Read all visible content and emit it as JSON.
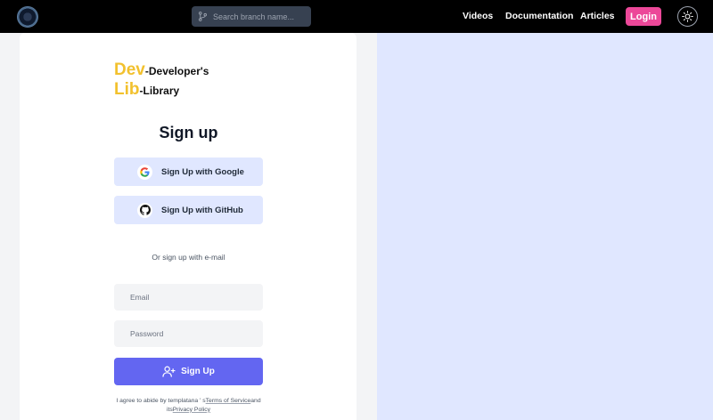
{
  "navbar": {
    "search_placeholder": "Search branch name...",
    "links": {
      "videos": "Videos",
      "documentation": "Documentation",
      "articles": "Articles"
    },
    "login_label": "Login",
    "icons": {
      "logo": "app-logo",
      "search": "git-branch-icon",
      "theme": "sun-icon"
    }
  },
  "brand": {
    "line1_big": "Dev",
    "line1_small": "-Developer's",
    "line2_big": "Lib",
    "line2_small": "-Library"
  },
  "signup": {
    "title": "Sign up",
    "google_label": "Sign Up with Google",
    "github_label": "Sign Up with GitHub",
    "divider": "Or sign up with e-mail",
    "email_placeholder": "Email",
    "password_placeholder": "Password",
    "submit_label": "Sign Up",
    "terms_prefix": "I agree to abide by templatana ' s",
    "terms_link": "Terms of Service",
    "terms_middle": "and its",
    "privacy_link": "Privacy Policy"
  },
  "colors": {
    "navbar_bg": "#000000",
    "accent": "#6366f1",
    "login": "#ec4899",
    "brand_yellow": "#f2c12e",
    "right_panel": "#e0e7ff"
  }
}
